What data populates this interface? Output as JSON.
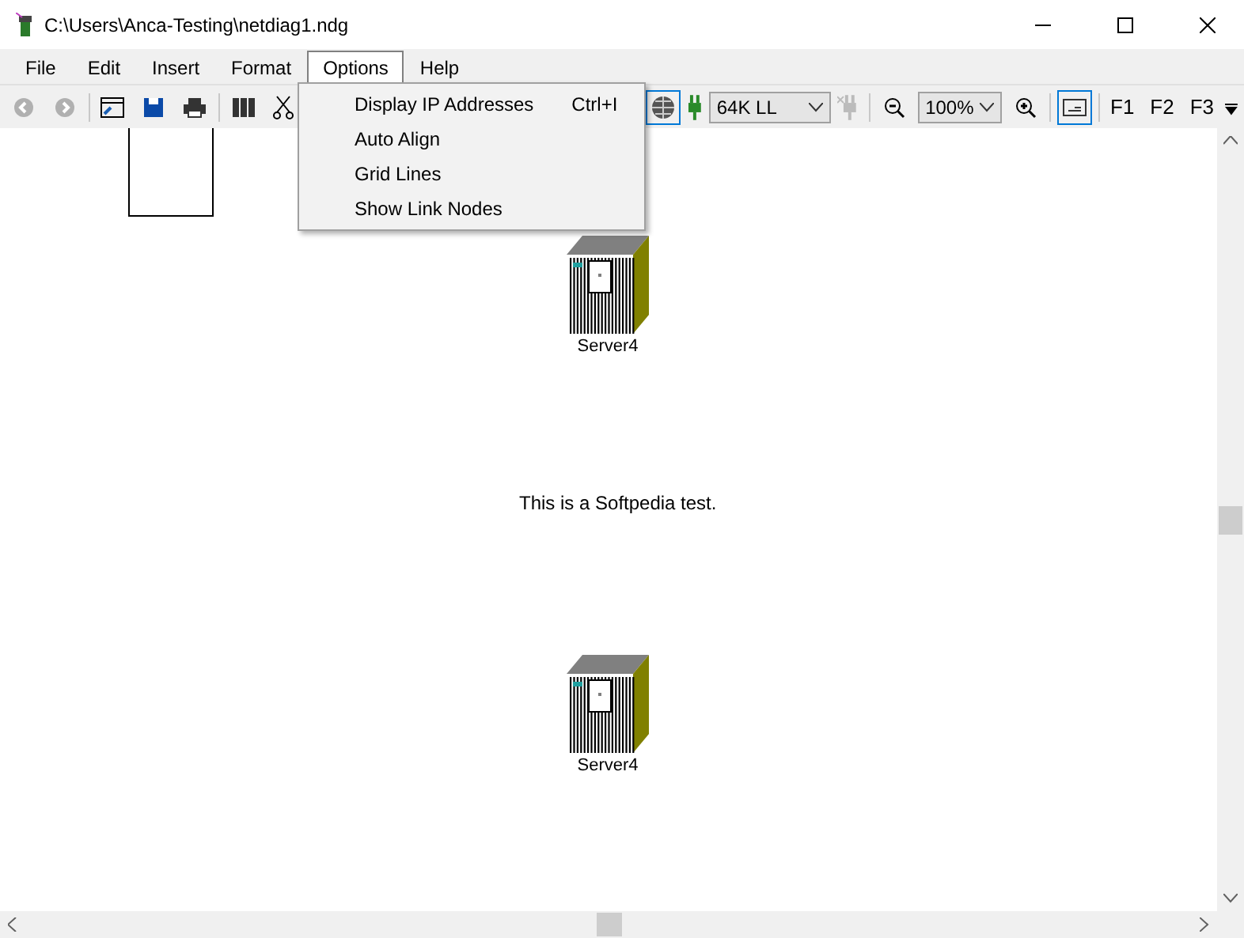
{
  "window": {
    "title": "C:\\Users\\Anca-Testing\\netdiag1.ndg"
  },
  "menu": [
    {
      "label": "File",
      "selected": false
    },
    {
      "label": "Edit",
      "selected": false
    },
    {
      "label": "Insert",
      "selected": false
    },
    {
      "label": "Format",
      "selected": false
    },
    {
      "label": "Options",
      "selected": true
    },
    {
      "label": "Help",
      "selected": false
    }
  ],
  "options_menu": [
    {
      "label": "Display IP Addresses",
      "shortcut": "Ctrl+I"
    },
    {
      "label": "Auto Align"
    },
    {
      "label": "Grid Lines"
    },
    {
      "label": "Show Link Nodes"
    }
  ],
  "toolbar": {
    "link_type": "64K LL",
    "zoom": "100%",
    "function_keys": [
      "F1",
      "F2",
      "F3"
    ]
  },
  "canvas": {
    "nodes": [
      {
        "name": "Server4"
      },
      {
        "name": "Server4"
      }
    ],
    "note": "This is a Softpedia test."
  }
}
